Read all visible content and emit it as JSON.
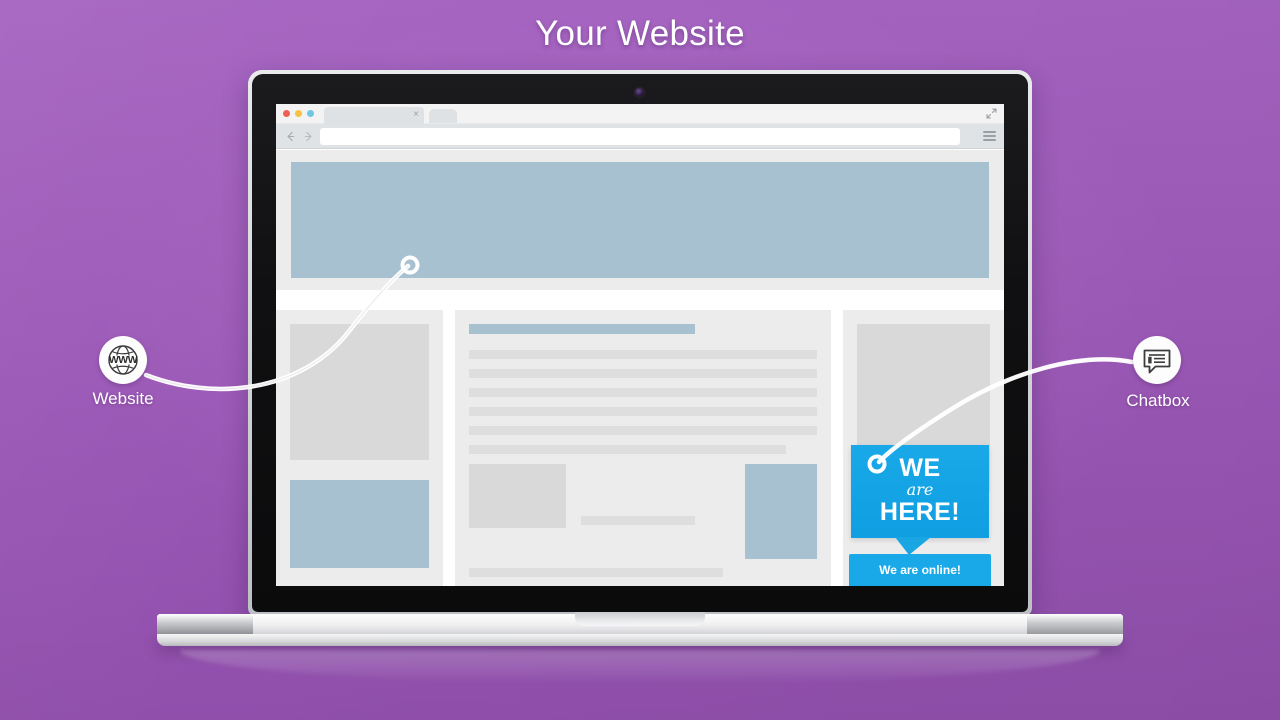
{
  "page": {
    "title": "Your Website",
    "background_color": "#9d5cbb"
  },
  "browser": {
    "traffic_lights": [
      {
        "name": "close",
        "color": "#ee5f56"
      },
      {
        "name": "minimize",
        "color": "#f5c343"
      },
      {
        "name": "maximize",
        "color": "#6fc7e1"
      }
    ],
    "tab": {
      "title": "",
      "close_label": "×"
    },
    "new_tab_label": "",
    "expand_icon": "expand-arrows-icon",
    "back_icon": "arrow-left-icon",
    "forward_icon": "arrow-right-icon",
    "url_value": "",
    "url_placeholder": "",
    "menu_icon": "hamburger-menu-icon"
  },
  "wireframe": {
    "hero_banner": {
      "color": "#a7c1d1"
    },
    "left_column": {
      "image_top": {
        "color": "#d9d9d9"
      },
      "image_bottom": {
        "color": "#a7c1d1"
      }
    },
    "main_column": {
      "title_bar": {
        "color": "#a7c1d1"
      },
      "text_lines": 6,
      "image_left": {
        "color": "#d9d9d9"
      },
      "image_right": {
        "color": "#a7c1d1"
      },
      "caption_line": {
        "color": "#dedede"
      },
      "bottom_lines": 2
    },
    "right_column": {
      "image": {
        "color": "#d9d9d9"
      }
    }
  },
  "chat_widget": {
    "line_1": "WE",
    "line_2": "are",
    "line_3": "HERE!",
    "status_label": "We are online!",
    "accent_color": "#19a9e8"
  },
  "callouts": [
    {
      "id": "website",
      "label": "Website",
      "icon": "globe-www-icon",
      "icon_text": "WWW"
    },
    {
      "id": "chatbox",
      "label": "Chatbox",
      "icon": "chat-bubble-icon"
    }
  ]
}
